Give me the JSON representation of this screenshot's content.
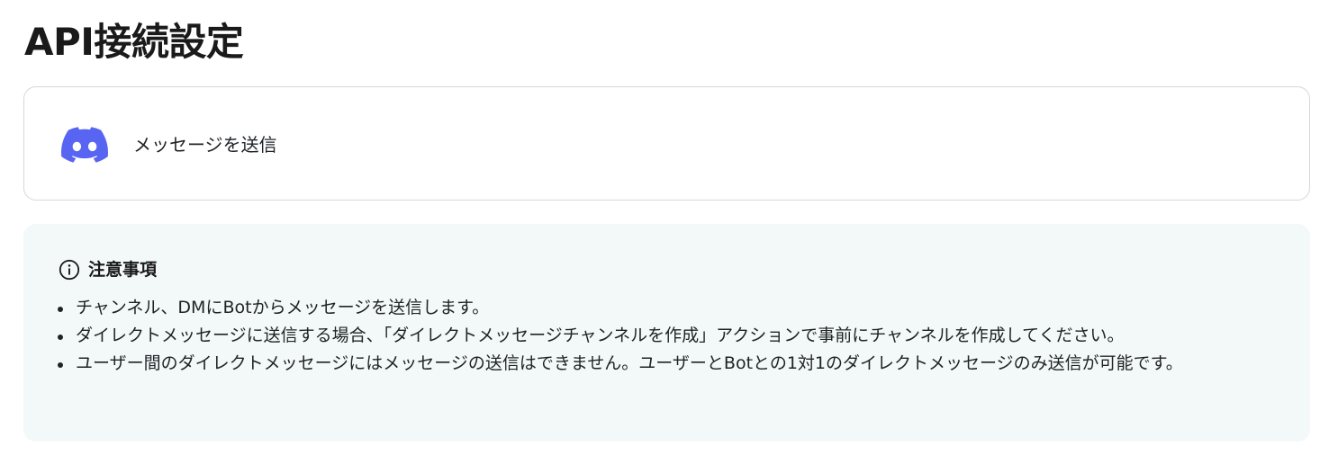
{
  "page": {
    "title": "API接続設定"
  },
  "action_card": {
    "icon": "discord-icon",
    "label": "メッセージを送信",
    "brand_color": "#5865F2"
  },
  "notice": {
    "icon": "info-icon",
    "title": "注意事項",
    "background": "#f3f8f8",
    "items": [
      "チャンネル、DMにBotからメッセージを送信します。",
      "ダイレクトメッセージに送信する場合、「ダイレクトメッセージチャンネルを作成」アクションで事前にチャンネルを作成してください。",
      "ユーザー間のダイレクトメッセージにはメッセージの送信はできません。ユーザーとBotとの1対1のダイレクトメッセージのみ送信が可能です。"
    ]
  }
}
